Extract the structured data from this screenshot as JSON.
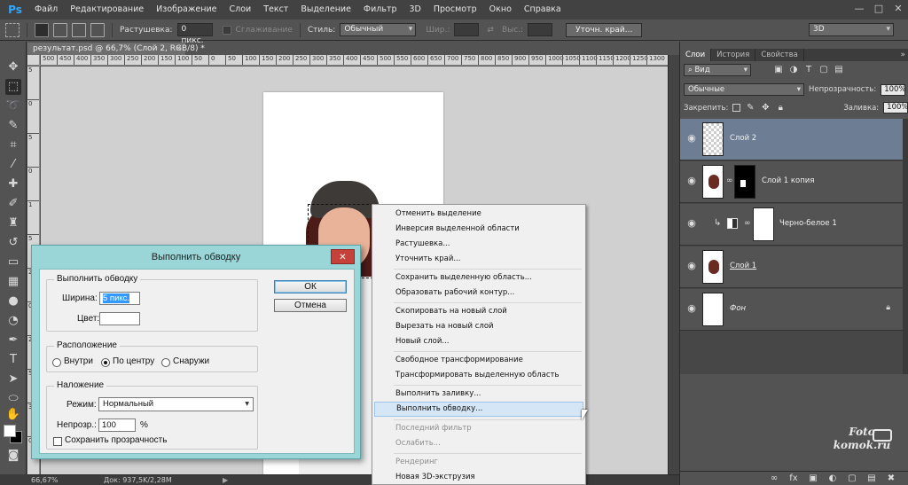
{
  "app": {
    "logo": "Ps"
  },
  "menubar": {
    "items": [
      "Файл",
      "Редактирование",
      "Изображение",
      "Слои",
      "Текст",
      "Выделение",
      "Фильтр",
      "3D",
      "Просмотр",
      "Окно",
      "Справка"
    ],
    "window_controls": {
      "minimize": "—",
      "restore": "□",
      "close": "✕"
    }
  },
  "options": {
    "feather_label": "Растушевка:",
    "feather_value": "0 пикс.",
    "antialias_label": "Сглаживание",
    "style_label": "Стиль:",
    "style_value": "Обычный",
    "width_label": "Шир.:",
    "height_label": "Выс.:",
    "refine_button": "Уточн. край...",
    "workspace_value": "3D"
  },
  "document": {
    "tab_title": "результат.psd @ 66,7% (Слой 2, RGB/8) *",
    "tab_close": "×",
    "ruler_top": [
      "500",
      "450",
      "400",
      "350",
      "300",
      "250",
      "200",
      "150",
      "100",
      "50",
      "0",
      "50",
      "100",
      "150",
      "200",
      "250",
      "300",
      "350",
      "400",
      "450",
      "500",
      "550",
      "600",
      "650",
      "700",
      "750",
      "800",
      "850",
      "900",
      "950",
      "1000",
      "1050",
      "1100",
      "1150",
      "1200",
      "1250",
      "1300"
    ],
    "ruler_left": [
      "5",
      "0",
      "5",
      "0",
      "1",
      "5",
      "2",
      "0",
      "2",
      "5",
      "3",
      "0"
    ]
  },
  "status": {
    "zoom": "66,67%",
    "doc_info": "Док: 937,5K/2,28M",
    "arrow": "▶"
  },
  "layers_panel": {
    "tabs": [
      "Слои",
      "История",
      "Свойства"
    ],
    "collapse": "»",
    "filter_label": "Вид",
    "blend_mode": "Обычные",
    "opacity_label": "Непрозрачность:",
    "opacity_value": "100%",
    "lock_label": "Закрепить:",
    "fill_label": "Заливка:",
    "fill_value": "100%",
    "layers": [
      {
        "name": "Слой 2"
      },
      {
        "name": "Слой 1 копия"
      },
      {
        "name": "Черно-белое 1"
      },
      {
        "name": "Слой 1"
      },
      {
        "name": "Фон"
      }
    ],
    "footer_icons": [
      "∞",
      "fx",
      "▣",
      "◐",
      "▢",
      "▤",
      "✖"
    ]
  },
  "watermark": {
    "line1": "Foto",
    "line2": "komok.ru"
  },
  "context_menu": {
    "items": [
      "Отменить выделение",
      "Инверсия выделенной области",
      "Растушевка...",
      "Уточнить край...",
      "Сохранить выделенную область...",
      "Образовать рабочий контур...",
      "Скопировать на новый слой",
      "Вырезать на новый слой",
      "Новый слой...",
      "Свободное трансформирование",
      "Трансформировать выделенную область",
      "Выполнить заливку...",
      "Выполнить обводку...",
      "Последний фильтр",
      "Ослабить...",
      "Рендеринг",
      "Новая 3D-экструзия"
    ],
    "highlighted_index": 12
  },
  "dialog": {
    "title": "Выполнить обводку",
    "close": "✕",
    "stroke_group": "Выполнить обводку",
    "width_label": "Ширина:",
    "width_value": "5 пикс.",
    "color_label": "Цвет:",
    "location_group": "Расположение",
    "inside_label": "Внутри",
    "center_label": "По центру",
    "outside_label": "Снаружи",
    "blend_group": "Наложение",
    "mode_label": "Режим:",
    "mode_value": "Нормальный",
    "opacity_label": "Непрозр.:",
    "opacity_value": "100",
    "percent": "%",
    "preserve_label": "Сохранить прозрачность",
    "ok": "ОК",
    "cancel": "Отмена"
  },
  "colors": {
    "accent": "#31a8ff",
    "dialog_frame": "#9ad6d8",
    "selected_layer": "#6d7d93",
    "menu_highlight": "#d5e6f7"
  }
}
